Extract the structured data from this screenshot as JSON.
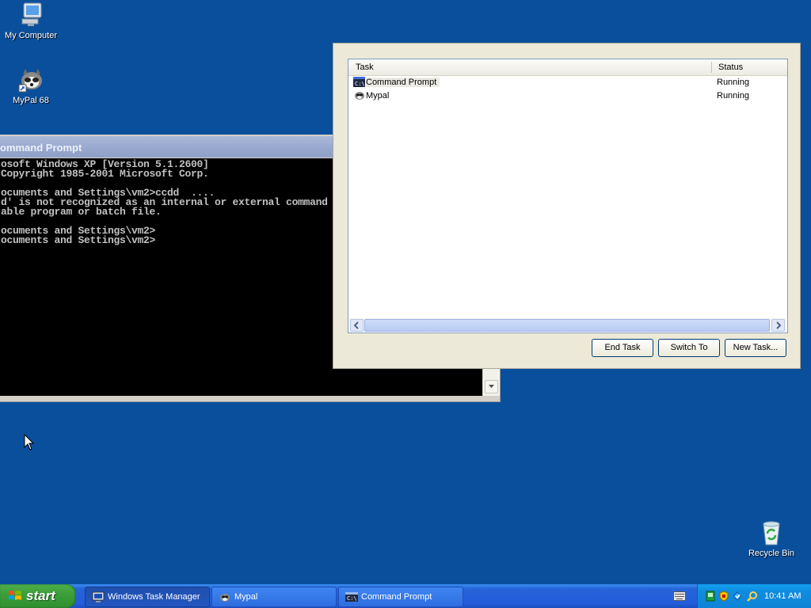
{
  "desktop": {
    "icons": [
      {
        "label": "My Computer",
        "icon": "my-computer-icon"
      },
      {
        "label": "MyPal 68",
        "icon": "mypal-icon"
      },
      {
        "label": "Recycle Bin",
        "icon": "recycle-bin-icon"
      }
    ]
  },
  "cmd_window": {
    "title": "ommand Prompt",
    "lines": [
      "osoft Windows XP [Version 5.1.2600]",
      "Copyright 1985-2001 Microsoft Corp.",
      "",
      "ocuments and Settings\\vm2>ccdd  ....",
      "d' is not recognized as an internal or external command",
      "able program or batch file.",
      "",
      "ocuments and Settings\\vm2>",
      "ocuments and Settings\\vm2>"
    ]
  },
  "task_manager": {
    "columns": {
      "task": "Task",
      "status": "Status"
    },
    "rows": [
      {
        "name": "Command Prompt",
        "status": "Running",
        "icon": "cmd-icon",
        "selected": true
      },
      {
        "name": "Mypal",
        "status": "Running",
        "icon": "mypal-icon",
        "selected": false
      }
    ],
    "buttons": {
      "end_task": "End Task",
      "switch_to": "Switch To",
      "new_task": "New Task..."
    }
  },
  "taskbar": {
    "start_label": "start",
    "items": [
      {
        "label": "Windows Task Manager",
        "icon": "task-manager-icon",
        "active": true
      },
      {
        "label": "Mypal",
        "icon": "mypal-icon",
        "active": false
      },
      {
        "label": "Command Prompt",
        "icon": "cmd-icon",
        "active": false
      }
    ],
    "clock": "10:41 AM"
  },
  "colors": {
    "desktop": "#0a4f9c",
    "taskbar": "#245ddb",
    "start": "#3c9f3a"
  }
}
